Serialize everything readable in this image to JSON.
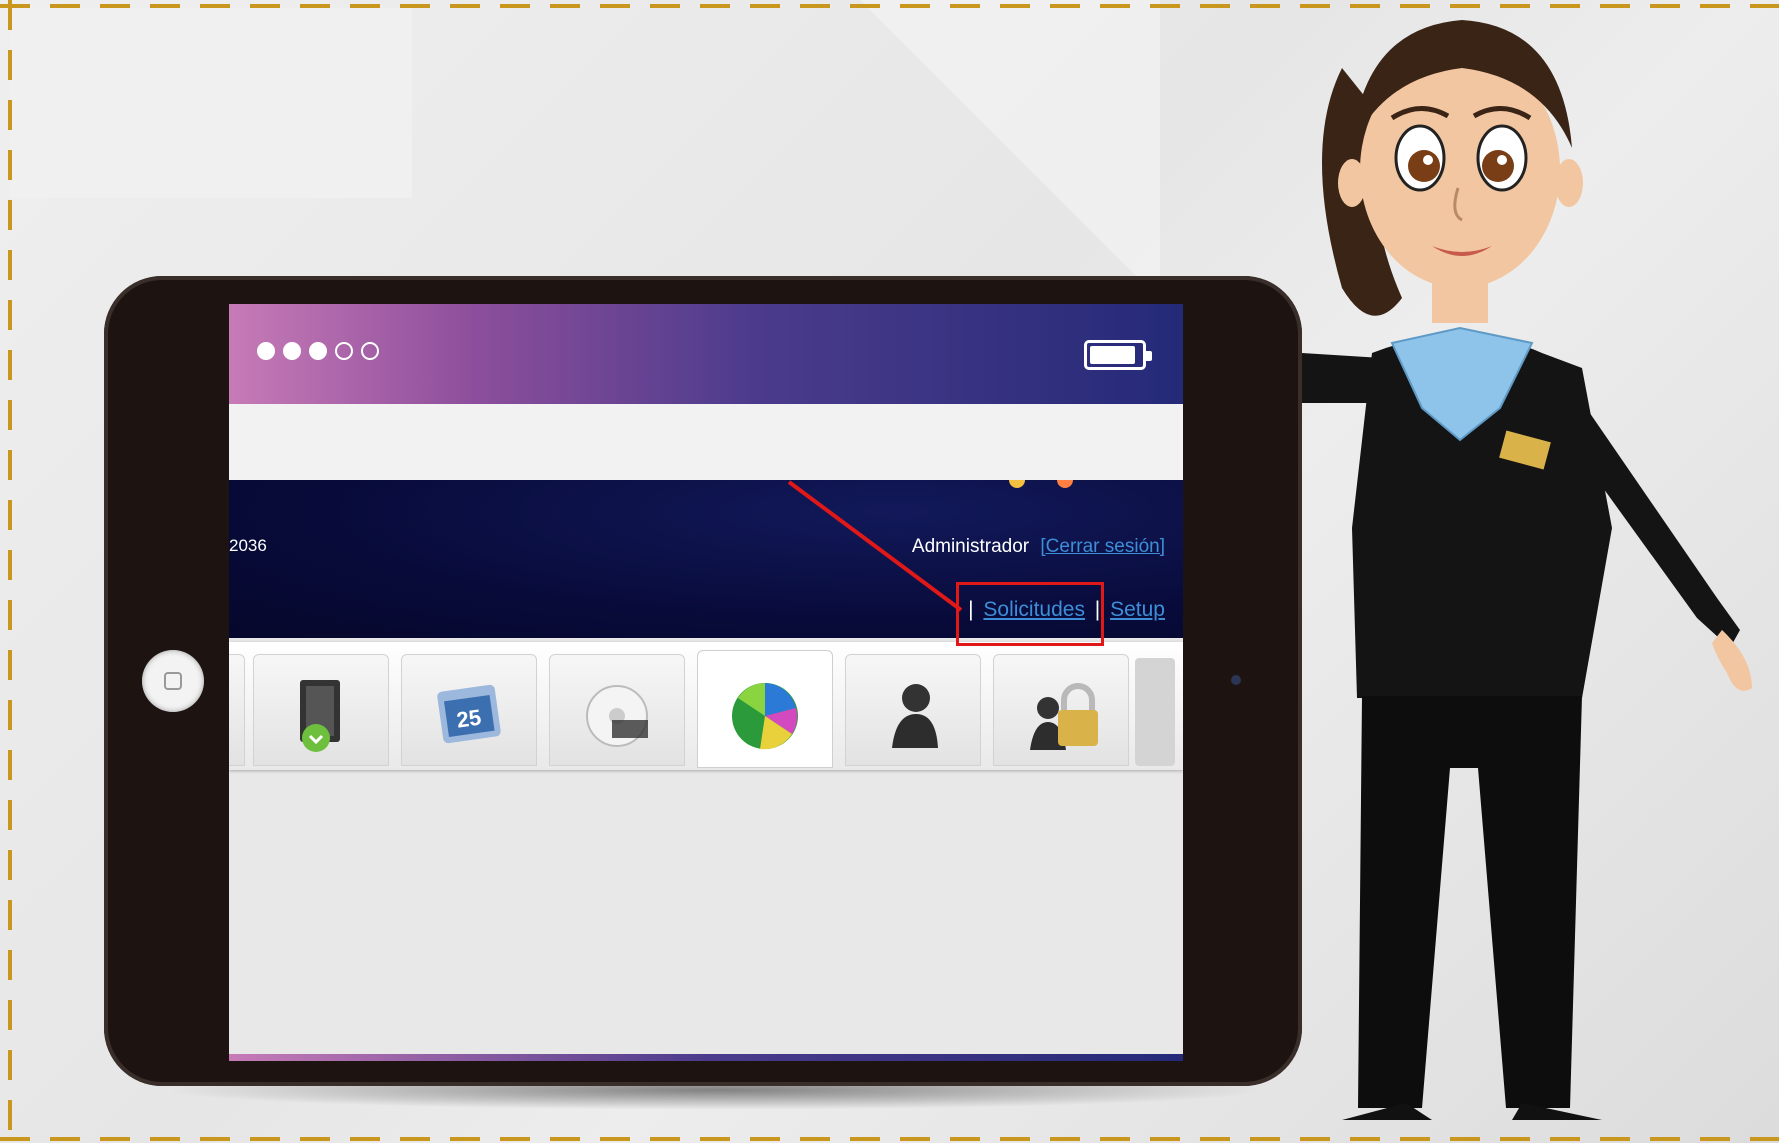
{
  "header": {
    "id_fragment": "2036",
    "user_name": "Administrador",
    "logout_label": "[Cerrar sesión]"
  },
  "nav": {
    "separator": "|",
    "items": [
      {
        "label": "Solicitudes",
        "highlighted": true
      },
      {
        "label": "Setup",
        "highlighted": false
      }
    ]
  },
  "status_bar": {
    "signal_strength": 3,
    "signal_max": 5,
    "battery_level": 0.9
  },
  "toolbar": {
    "icons": [
      {
        "name": "partial-icon",
        "active": false
      },
      {
        "name": "folder-download-icon",
        "active": false
      },
      {
        "name": "calendar-25-icon",
        "active": false
      },
      {
        "name": "disc-icon",
        "active": false
      },
      {
        "name": "pie-chart-icon",
        "active": true
      },
      {
        "name": "user-icon",
        "active": false
      },
      {
        "name": "user-lock-icon",
        "active": false
      }
    ]
  },
  "colors": {
    "highlight": "#e01818",
    "link": "#3d8dd8",
    "frame_dash": "#c9961e"
  }
}
